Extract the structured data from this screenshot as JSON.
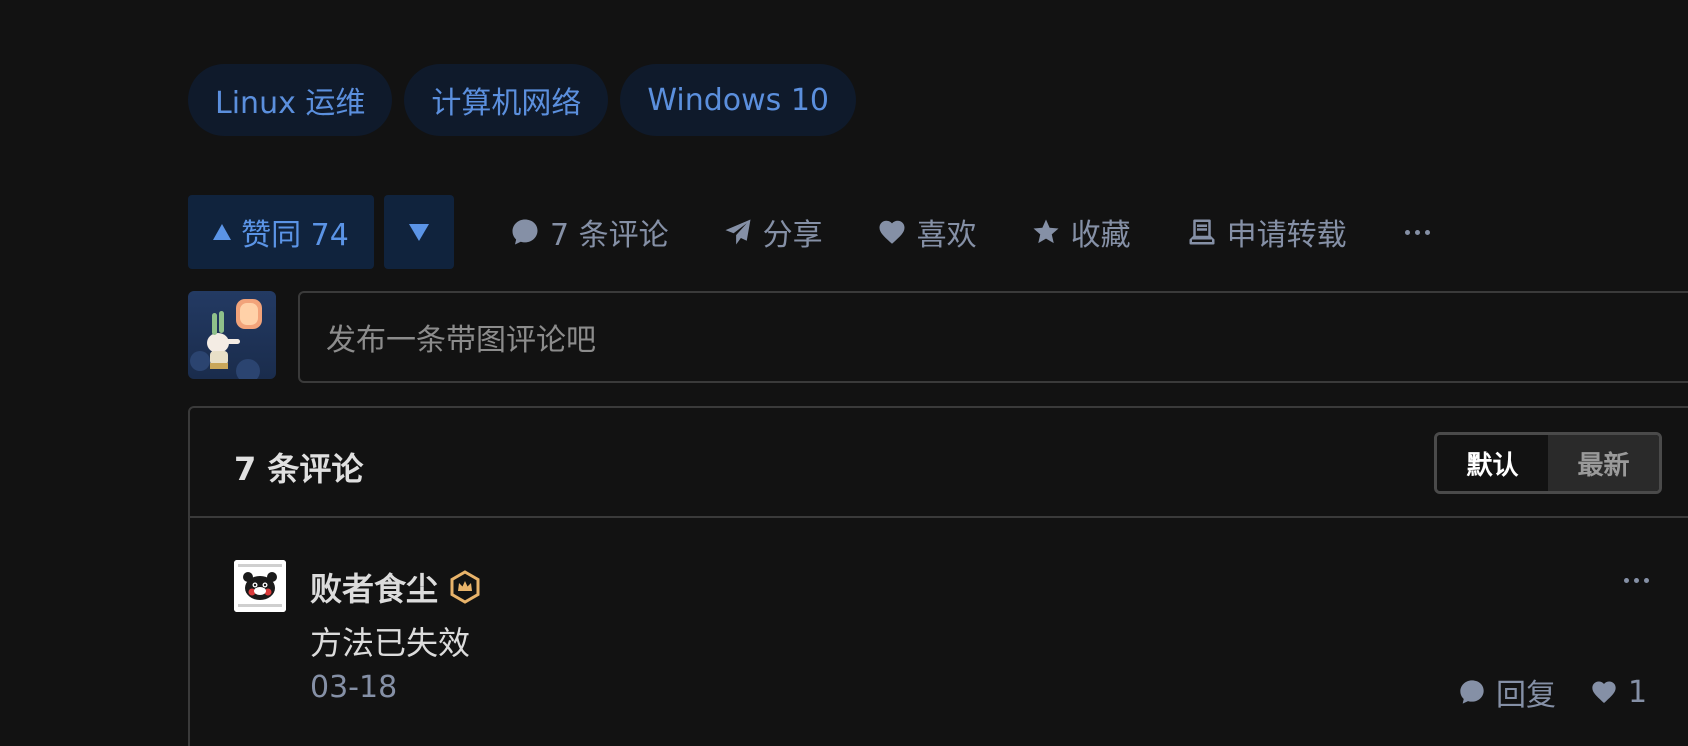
{
  "tags": [
    "Linux 运维",
    "计算机网络",
    "Windows 10"
  ],
  "actions": {
    "upvote_label": "赞同 74",
    "comment_label": "7 条评论",
    "share_label": "分享",
    "like_label": "喜欢",
    "favorite_label": "收藏",
    "repost_label": "申请转载"
  },
  "comment_input": {
    "placeholder": "发布一条带图评论吧"
  },
  "comments_panel": {
    "title": "7 条评论",
    "sort_default": "默认",
    "sort_latest": "最新",
    "items": [
      {
        "author": "败者食尘",
        "text": "方法已失效",
        "date": "03-18",
        "reply_label": "回复",
        "likes": "1"
      }
    ]
  },
  "colors": {
    "background": "#121212",
    "accent": "#5b8fdd",
    "tag_bg": "#0f1a2b",
    "muted": "#8590a6",
    "badge": "#e8b36a"
  },
  "icons": {
    "upvote": "triangle-up-icon",
    "downvote": "triangle-down-icon",
    "comment": "comment-bubble-icon",
    "share": "paper-plane-icon",
    "like": "heart-icon",
    "favorite": "star-icon",
    "repost": "repost-icon",
    "more": "more-dots-icon",
    "badge": "crown-badge-icon"
  }
}
